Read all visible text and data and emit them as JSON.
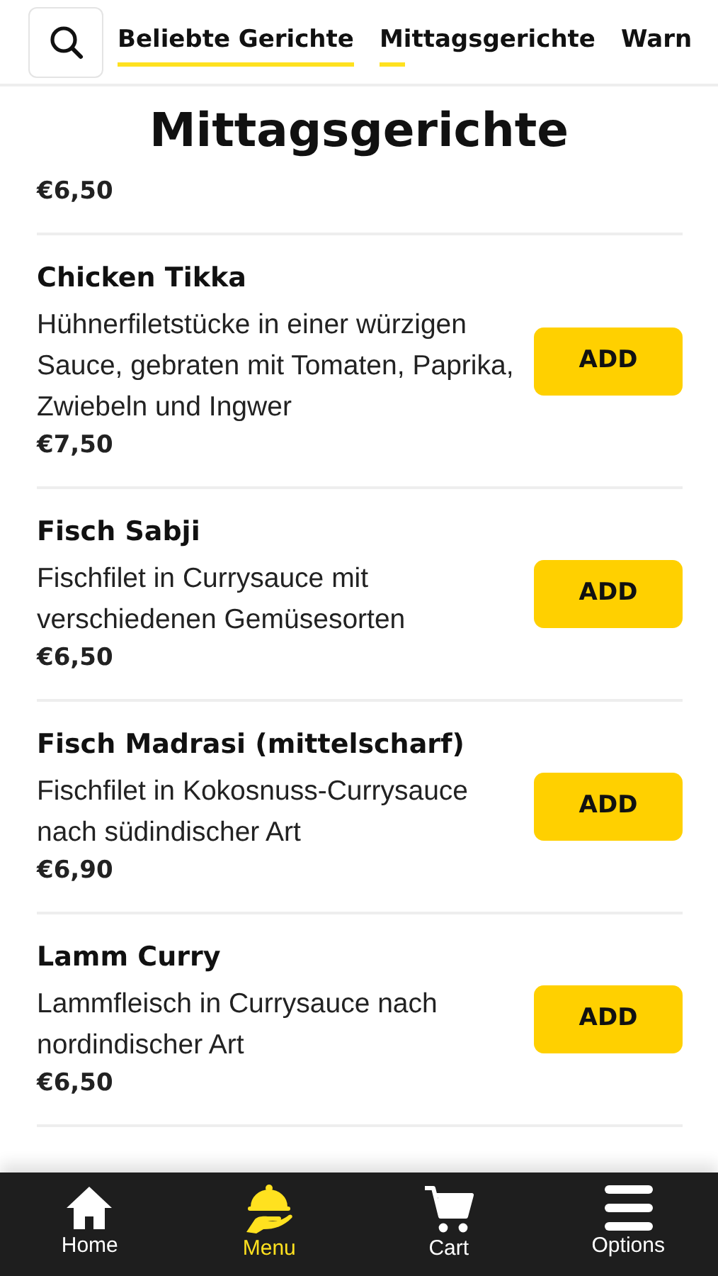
{
  "tabs": [
    {
      "label": "Beliebte Gerichte",
      "level": 1
    },
    {
      "label": "Mittagsgerichte",
      "level": 0.12
    },
    {
      "label": "Warn"
    }
  ],
  "section": {
    "title": "Mittagsgerichte"
  },
  "items": [
    {
      "kind": "partial",
      "price": "€6,50"
    },
    {
      "kind": "dish",
      "name": "Chicken Tikka",
      "description": "Hühnerfiletstücke in einer würzigen Sauce, gebraten mit Tomaten, Paprika, Zwiebeln und Ingwer",
      "price": "€7,50",
      "button": "ADD"
    },
    {
      "kind": "dish",
      "name": "Fisch Sabji",
      "description": "Fischfilet in Currysauce mit verschiedenen Gemüsesorten",
      "price": "€6,50",
      "button": "ADD"
    },
    {
      "kind": "dish",
      "name": "Fisch Madrasi (mittelscharf)",
      "description": "Fischfilet in Kokosnuss-Currysauce nach südindischer Art",
      "price": "€6,90",
      "button": "ADD"
    },
    {
      "kind": "dish",
      "name": "Lamm Curry",
      "description": "Lammfleisch in Currysauce nach nordindischer Art",
      "price": "€6,50",
      "button": "ADD"
    }
  ],
  "bottom_nav": [
    {
      "label": "Home",
      "kind": "home",
      "selected": false
    },
    {
      "label": "Menu",
      "kind": "menu",
      "selected": true
    },
    {
      "label": "Cart",
      "kind": "cart",
      "selected": false
    },
    {
      "label": "Options",
      "kind": "options",
      "selected": false
    }
  ]
}
